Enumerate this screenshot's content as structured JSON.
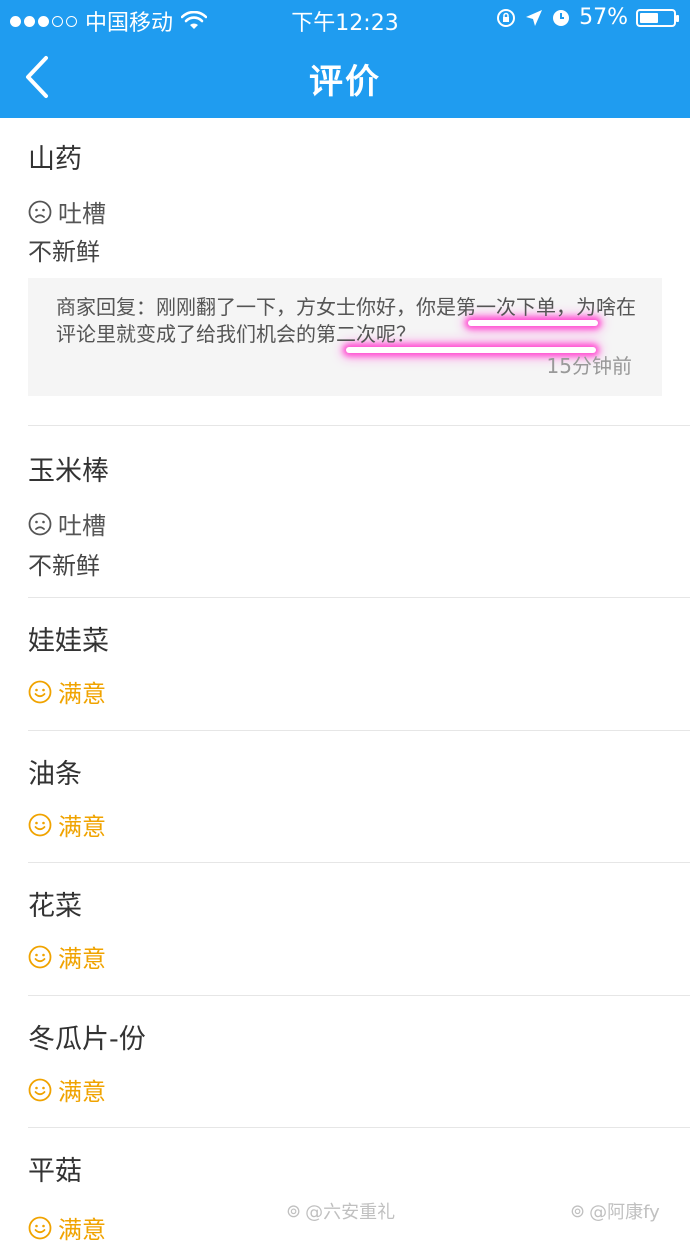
{
  "status_bar": {
    "carrier": "中国移动",
    "time": "下午12:23",
    "battery_text": "57%",
    "battery_level": 0.57,
    "icons": [
      "signal-dots",
      "wifi-icon",
      "rotation-lock-icon",
      "location-arrow-icon",
      "alarm-icon",
      "battery-icon"
    ]
  },
  "navbar": {
    "back_icon": "chevron-left-icon",
    "title": "评价"
  },
  "reviews": [
    {
      "dish": "山药",
      "rating_label": "吐槽",
      "rating_type": "complaint",
      "comment": "不新鲜",
      "reply": {
        "text": "商家回复：刚刚翻了一下，方女士你好，你是第一次下单，为啥在评论里就变成了给我们机会的第二次呢？",
        "time": "15分钟前"
      }
    },
    {
      "dish": "玉米棒",
      "rating_label": "吐槽",
      "rating_type": "complaint",
      "comment": "不新鲜"
    },
    {
      "dish": "娃娃菜",
      "rating_label": "满意",
      "rating_type": "satisfied"
    },
    {
      "dish": "油条",
      "rating_label": "满意",
      "rating_type": "satisfied"
    },
    {
      "dish": "花菜",
      "rating_label": "满意",
      "rating_type": "satisfied"
    },
    {
      "dish": "冬瓜片-份",
      "rating_label": "满意",
      "rating_type": "satisfied"
    },
    {
      "dish": "平菇",
      "rating_label": "满意",
      "rating_type": "satisfied"
    }
  ],
  "colors": {
    "header_blue": "#1f9cf0",
    "satisfied_orange": "#f0a300",
    "highlight_pink": "#ff4fd2"
  },
  "watermarks": [
    "@六安重礼",
    "@阿康fy"
  ]
}
